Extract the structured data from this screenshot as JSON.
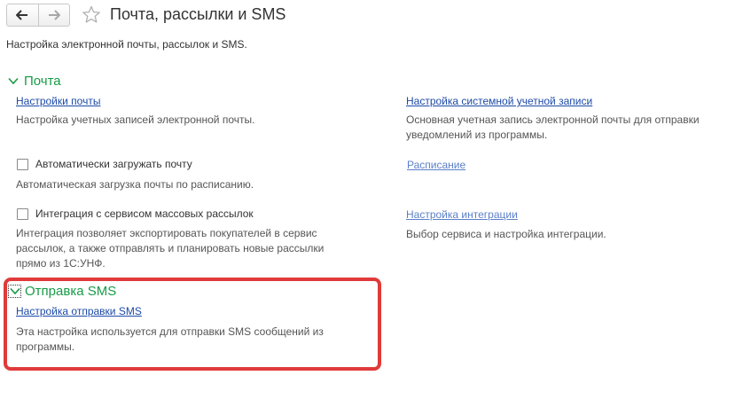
{
  "header": {
    "title": "Почта, рассылки и SMS",
    "description": "Настройка электронной почты, рассылок и SMS."
  },
  "groups": {
    "mail": {
      "title": "Почта",
      "left": {
        "mail_settings": {
          "link": "Настройки почты",
          "desc": "Настройка учетных записей электронной почты."
        },
        "auto_load": {
          "label": "Автоматически загружать почту",
          "checked": false,
          "desc": "Автоматическая загрузка почты по расписанию."
        },
        "integration": {
          "label": "Интеграция с сервисом массовых рассылок",
          "checked": false,
          "desc_line1": "Интеграция позволяет экспортировать покупателей в сервис",
          "desc_line2": "рассылок, а также отправлять и планировать новые рассылки",
          "desc_line3": "прямо из 1С:УНФ."
        }
      },
      "right": {
        "system_account": {
          "link": "Настройка системной учетной записи",
          "desc_line1": "Основная учетная запись электронной почты для отправки",
          "desc_line2": "уведомлений из программы."
        },
        "schedule": {
          "link": "Расписание"
        },
        "integration_settings": {
          "link": "Настройка интеграции",
          "desc": "Выбор сервиса и настройка интеграции."
        }
      }
    },
    "sms": {
      "title": "Отправка SMS",
      "link": "Настройка отправки SMS",
      "desc_line1": "Эта настройка используется для отправки SMS сообщений из",
      "desc_line2": "программы."
    }
  },
  "colors": {
    "group_header": "#169b45",
    "link": "#1c4aa8",
    "link_dim": "#5b7fc8",
    "highlight": "#e03a3a"
  },
  "icons": {
    "back": "arrow-left-icon",
    "forward": "arrow-right-icon",
    "favorite": "star-icon",
    "collapse": "chevron-down-icon"
  }
}
